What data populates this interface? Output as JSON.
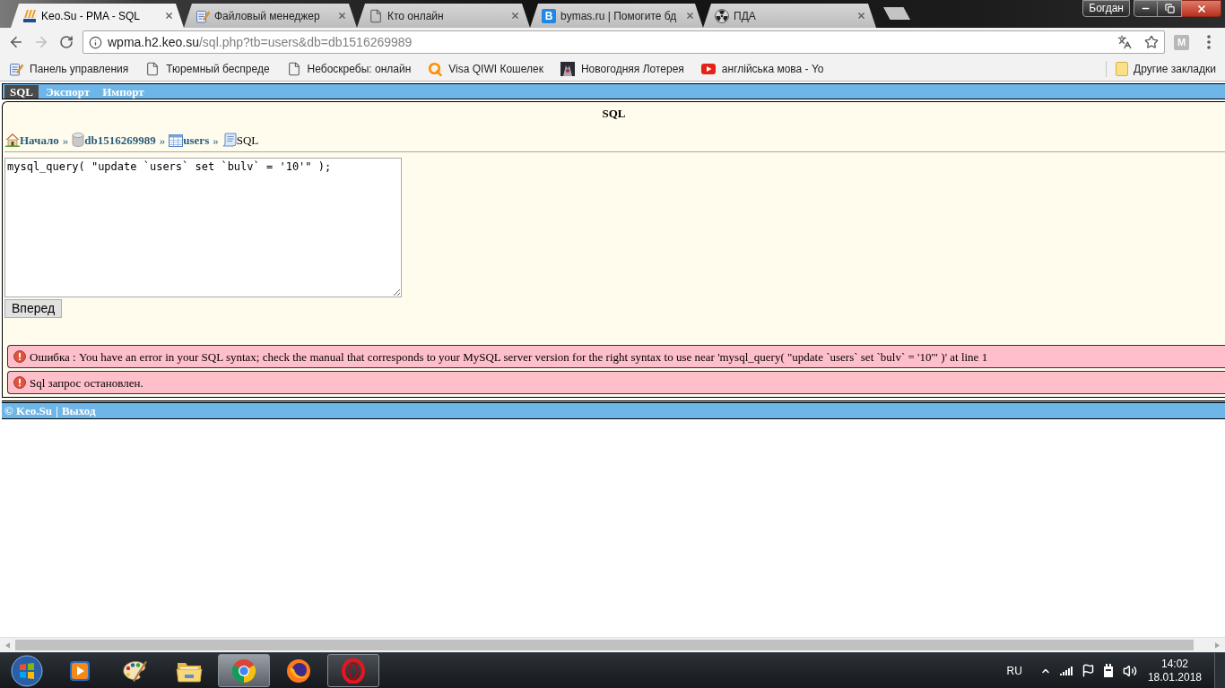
{
  "window": {
    "user": "Богдан"
  },
  "tabs": [
    {
      "title": "Keo.Su - PMA - SQL",
      "kind": "pma",
      "selected": true
    },
    {
      "title": "Файловый менеджер",
      "kind": "notepad",
      "selected": false
    },
    {
      "title": "Кто онлайн",
      "kind": "page",
      "selected": false
    },
    {
      "title": "bymas.ru | Помогите бд",
      "kind": "letter",
      "letter": "B",
      "selected": false
    },
    {
      "title": "ПДА",
      "kind": "radiation",
      "selected": false
    }
  ],
  "address_bar": {
    "host": "wpma.h2.keo.su",
    "path": "/sql.php?tb=users&db=db1516269989"
  },
  "extension": {
    "label": "M"
  },
  "bookmarks": [
    {
      "label": "Панель управления",
      "kind": "notepad"
    },
    {
      "label": "Тюремный беспреде",
      "kind": "page"
    },
    {
      "label": "Небоскребы: онлайн",
      "kind": "page"
    },
    {
      "label": "Visa QIWI Кошелек",
      "kind": "ring"
    },
    {
      "label": "Новогодняя Лотерея",
      "kind": "thumbnail"
    },
    {
      "label": "англійська мова - Yo",
      "kind": "video"
    }
  ],
  "other_bookmarks": "Другие закладки",
  "page": {
    "menu": [
      {
        "label": "SQL",
        "selected": true
      },
      {
        "label": "Экспорт",
        "selected": false
      },
      {
        "label": "Импорт",
        "selected": false
      }
    ],
    "title": "SQL",
    "breadcrumb": {
      "separator": "»",
      "items": [
        {
          "label": "Начало",
          "kind": "home",
          "link": true
        },
        {
          "label": "db1516269989",
          "kind": "database",
          "link": true
        },
        {
          "label": "users",
          "kind": "table",
          "link": true
        },
        {
          "label": "SQL",
          "kind": "sql",
          "link": false
        }
      ]
    },
    "query": "mysql_query( \"update `users` set `bulv` = '10'\" );",
    "submit": "Вперед",
    "messages": [
      {
        "kind": "error",
        "text": "Ошибка : You have an error in your SQL syntax; check the manual that corresponds to your MySQL server version for the right syntax to use near 'mysql_query( \"update `users` set `bulv` = '10'\" )' at line 1"
      },
      {
        "kind": "error",
        "text": "Sql запрос остановлен."
      }
    ],
    "footer": {
      "separator": "|",
      "links": [
        "© Keo.Su",
        "Выход"
      ]
    }
  },
  "taskbar": {
    "apps": [
      {
        "kind": "media",
        "running": false,
        "selected": false
      },
      {
        "kind": "paint",
        "running": false,
        "selected": false
      },
      {
        "kind": "explorer",
        "running": false,
        "selected": false
      },
      {
        "kind": "chrome",
        "running": true,
        "selected": true
      },
      {
        "kind": "firefox",
        "running": false,
        "selected": false
      },
      {
        "kind": "opera",
        "running": true,
        "selected": false
      }
    ],
    "language": "RU",
    "time": "14:02",
    "date": "18.01.2018"
  }
}
